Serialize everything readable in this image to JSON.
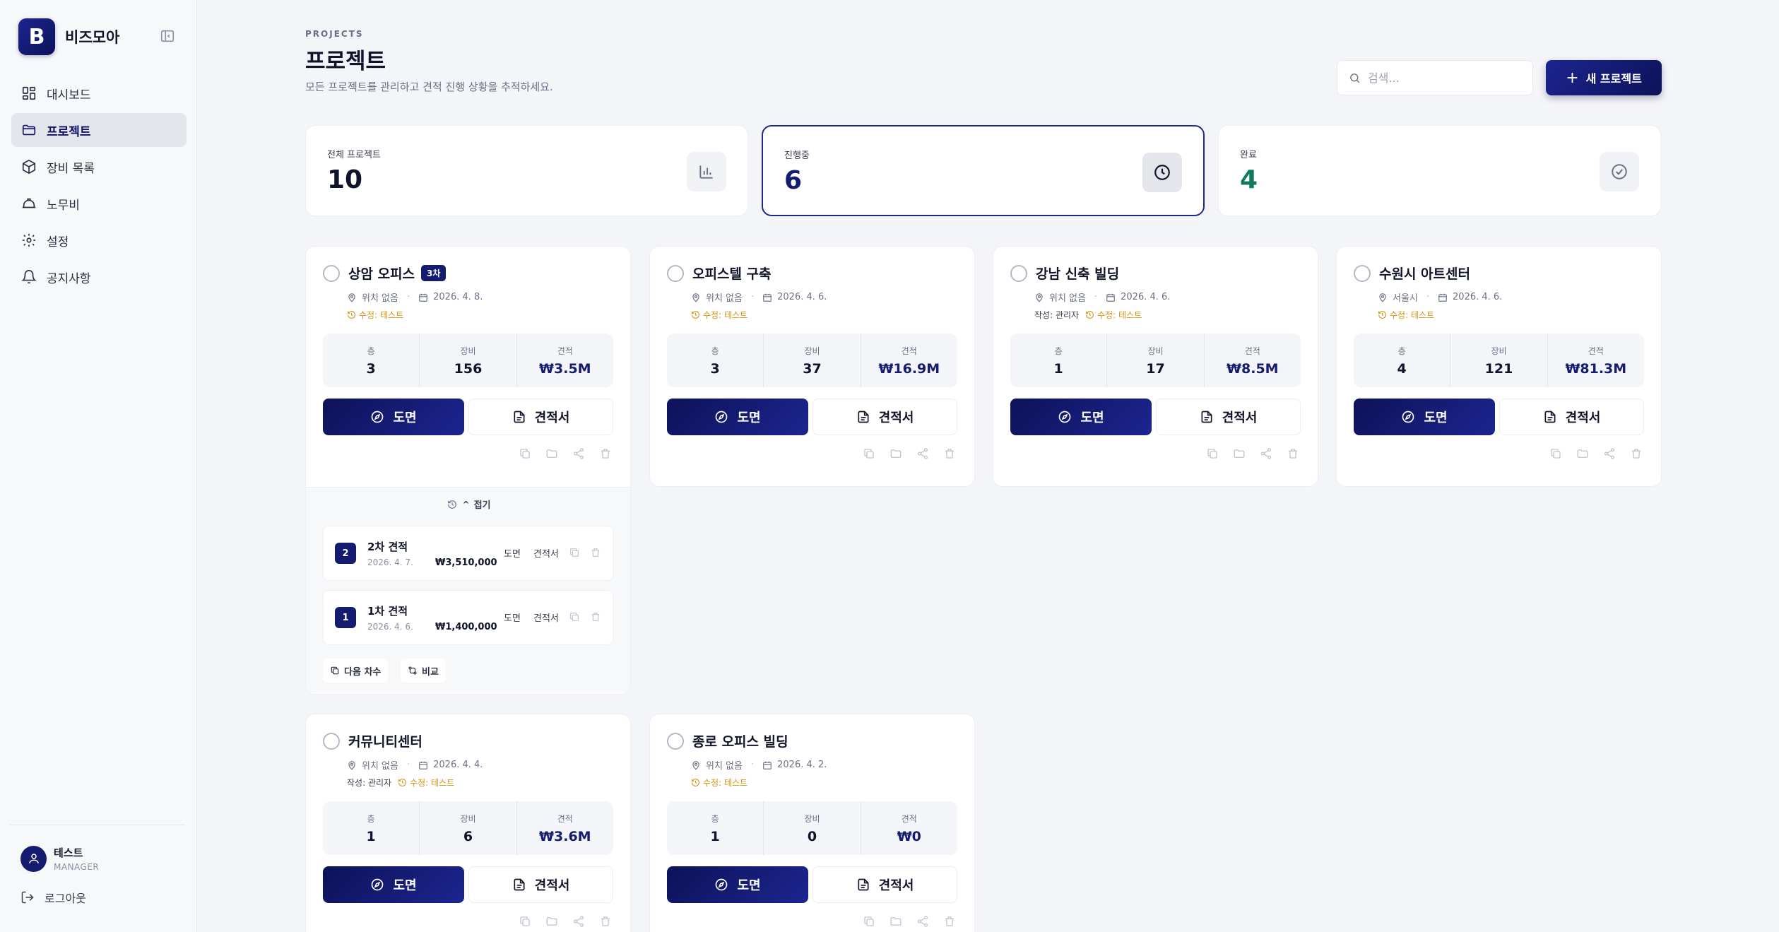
{
  "app": {
    "logo_letter": "B",
    "name": "비즈모아"
  },
  "nav": [
    {
      "label": "대시보드",
      "icon": "dashboard-icon"
    },
    {
      "label": "프로젝트",
      "icon": "folder-icon",
      "active": true
    },
    {
      "label": "장비 목록",
      "icon": "box-icon"
    },
    {
      "label": "노무비",
      "icon": "hardhat-icon"
    },
    {
      "label": "설정",
      "icon": "gear-icon"
    },
    {
      "label": "공지사항",
      "icon": "bell-icon"
    }
  ],
  "user": {
    "name": "테스트",
    "role": "MANAGER"
  },
  "logout_label": "로그아웃",
  "header": {
    "eyebrow": "PROJECTS",
    "title": "프로젝트",
    "subtitle": "모든 프로젝트를 관리하고 견적 진행 상황을 추적하세요.",
    "search_placeholder": "검색...",
    "new_button": "새 프로젝트"
  },
  "stats": [
    {
      "label": "전체 프로젝트",
      "value": "10",
      "color": "#10132a"
    },
    {
      "label": "진행중",
      "value": "6",
      "color": "#151b6e"
    },
    {
      "label": "완료",
      "value": "4",
      "color": "#0f7a5c"
    }
  ],
  "labels": {
    "floors": "층",
    "equipment": "장비",
    "estimate": "견적",
    "drawing_button": "도면",
    "estimate_button": "견적서",
    "collapse": "접기",
    "next_round": "다음 차수",
    "compare": "비교",
    "rev_drawing": "도면",
    "rev_estimate": "견적서"
  },
  "projects": [
    {
      "name": "상암 오피스",
      "badge": "3차",
      "location": "위치 없음",
      "date": "2026. 4. 8.",
      "author": "",
      "modified": "수정: 테스트",
      "floors": "3",
      "equipment": "156",
      "estimate": "₩3.5M"
    },
    {
      "name": "오피스텔 구축",
      "badge": "",
      "location": "위치 없음",
      "date": "2026. 4. 6.",
      "author": "",
      "modified": "수정: 테스트",
      "floors": "3",
      "equipment": "37",
      "estimate": "₩16.9M"
    },
    {
      "name": "강남 신축 빌딩",
      "badge": "",
      "location": "위치 없음",
      "date": "2026. 4. 6.",
      "author": "작성: 관리자",
      "modified": "수정: 테스트",
      "floors": "1",
      "equipment": "17",
      "estimate": "₩8.5M"
    },
    {
      "name": "수원시 아트센터",
      "badge": "",
      "location": "서울시",
      "date": "2026. 4. 6.",
      "author": "",
      "modified": "수정: 테스트",
      "floors": "4",
      "equipment": "121",
      "estimate": "₩81.3M"
    },
    {
      "name": "커뮤니티센터",
      "badge": "",
      "location": "위치 없음",
      "date": "2026. 4. 4.",
      "author": "작성: 관리자",
      "modified": "수정: 테스트",
      "floors": "1",
      "equipment": "6",
      "estimate": "₩3.6M"
    },
    {
      "name": "종로 오피스 빌딩",
      "badge": "",
      "location": "위치 없음",
      "date": "2026. 4. 2.",
      "author": "",
      "modified": "수정: 테스트",
      "floors": "1",
      "equipment": "0",
      "estimate": "₩0"
    }
  ],
  "revisions": [
    {
      "num": "2",
      "title": "2차 견적",
      "date": "2026. 4. 7.",
      "amount": "₩3,510,000"
    },
    {
      "num": "1",
      "title": "1차 견적",
      "date": "2026. 4. 6.",
      "amount": "₩1,400,000"
    }
  ]
}
